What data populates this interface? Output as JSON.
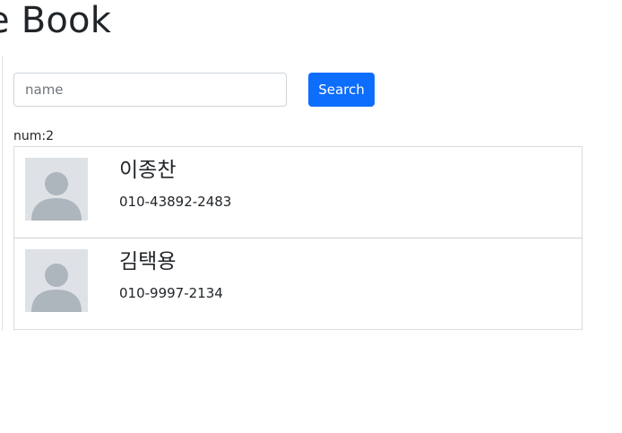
{
  "header": {
    "title": "e Book"
  },
  "search": {
    "placeholder": "name",
    "value": "",
    "button_label": "Search"
  },
  "results": {
    "count_text": "num:2",
    "contacts": [
      {
        "name": "이종찬",
        "phone": "010-43892-2483",
        "avatar": "person-icon"
      },
      {
        "name": "김택용",
        "phone": "010-9997-2134",
        "avatar": "person-icon"
      }
    ]
  },
  "colors": {
    "primary": "#0d6efd",
    "avatar_bg": "#dee2e6",
    "avatar_fg": "#adb5bd",
    "border": "#dcdcdc"
  }
}
